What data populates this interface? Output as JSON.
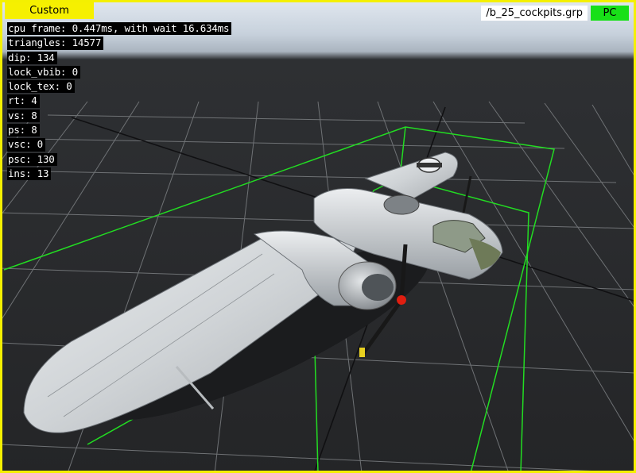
{
  "toolbar": {
    "mode_label": "Custom",
    "file_name": "/b_25_cockpits.grp",
    "platform": "PC"
  },
  "stats": [
    "cpu frame: 0.447ms, with wait 16.634ms",
    "triangles: 14577",
    "dip: 134",
    "lock_vbib: 0",
    "lock_tex: 0",
    "rt: 4",
    "vs: 8",
    "ps: 8",
    "vsc: 0",
    "psc: 130",
    "ins: 13"
  ],
  "colors": {
    "frame_border": "#f4f000",
    "mode_tab": "#f6f000",
    "platform_badge": "#18e018",
    "bounding_box": "#22dd22",
    "grid": "#6f7275",
    "floor": "#262729"
  }
}
